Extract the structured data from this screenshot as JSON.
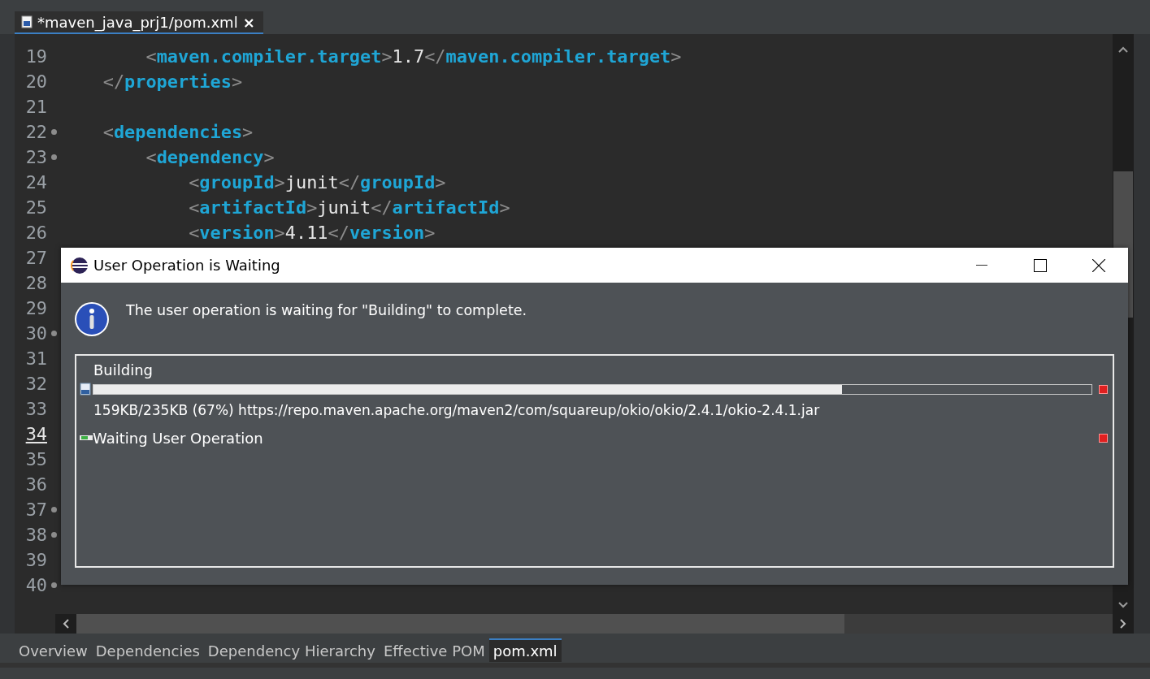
{
  "editor_tab": {
    "title": "*maven_java_prj1/pom.xml",
    "close": "×",
    "selected": true
  },
  "code_lines": [
    {
      "number": "19",
      "text": "        <maven.compiler.target>1.7</maven.compiler.target>"
    },
    {
      "number": "20",
      "text": "    </properties>"
    },
    {
      "number": "21"
    },
    {
      "number": "22",
      "fold": true,
      "text": "    <dependencies>"
    },
    {
      "number": "23",
      "fold": true,
      "text": "        <dependency>"
    },
    {
      "number": "24",
      "text": "            <groupId>junit</groupId>"
    },
    {
      "number": "25",
      "text": "            <artifactId>junit</artifactId>"
    },
    {
      "number": "26",
      "text": "            <version>4.11</version>"
    },
    {
      "number": "27"
    },
    {
      "number": "28"
    },
    {
      "number": "29"
    },
    {
      "number": "30",
      "fold": true
    },
    {
      "number": "31"
    },
    {
      "number": "32"
    },
    {
      "number": "33"
    },
    {
      "number": "34",
      "current": true
    },
    {
      "number": "35"
    },
    {
      "number": "36"
    },
    {
      "number": "37",
      "fold": true
    },
    {
      "number": "38",
      "fold": true
    },
    {
      "number": "39"
    },
    {
      "number": "40",
      "fold": true
    }
  ],
  "dialog": {
    "title": "User Operation is Waiting",
    "message": "The user operation is waiting for \"Building\" to complete.",
    "jobs": [
      {
        "kind": "progress",
        "name": "Building",
        "level": 0.75,
        "detail": "159KB/235KB (67%) https://repo.maven.apache.org/maven2/com/squareup/okio/okio/2.4.1/okio-2.4.1.jar"
      },
      {
        "kind": "waiting",
        "name": "Waiting User Operation"
      }
    ]
  },
  "page_tabs": [
    {
      "label": "Overview",
      "selected": false
    },
    {
      "label": "Dependencies",
      "selected": false
    },
    {
      "label": "Dependency Hierarchy",
      "selected": false
    },
    {
      "label": "Effective POM",
      "selected": false
    },
    {
      "label": "pom.xml",
      "selected": true
    }
  ]
}
